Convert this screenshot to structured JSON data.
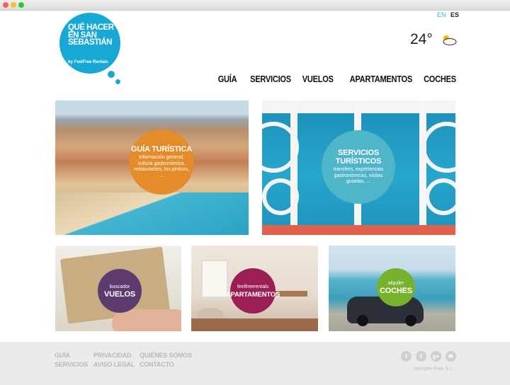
{
  "window": {
    "chrome_buttons": [
      "close",
      "minimize",
      "maximize"
    ]
  },
  "lang": {
    "en": "EN",
    "es": "ES",
    "active": "ES"
  },
  "logo": {
    "title_lines": [
      "QUÉ HACER",
      "EN SAN",
      "SEBASTIÁN"
    ],
    "subtitle": "by FeelFree Rentals",
    "color": "#18a8d5"
  },
  "weather": {
    "temperature": "24°",
    "icon": "partly-cloudy-icon"
  },
  "nav": [
    "GUÍA",
    "SERVICIOS",
    "VUELOS",
    "APARTAMENTOS",
    "COCHES"
  ],
  "tiles": {
    "guia": {
      "title": "GUÍA TURÍSTICA",
      "description": "Información general, cultura gastronómica, restaurantes, los pintxos, ...",
      "color": "#e48b2a"
    },
    "servicios": {
      "title": "SERVICIOS TURÍSTICOS",
      "description": "transfers, experiencias gastronómicas, visitas guiadas, ...",
      "color": "#4fb5c9"
    },
    "vuelos": {
      "pretitle": "buscador",
      "title": "VUELOS",
      "color": "#5d3b6e"
    },
    "apartamentos": {
      "pretitle": "feelfreerentals",
      "title": "APARTAMENTOS",
      "color": "#9c1f54"
    },
    "coches": {
      "pretitle": "alquiler",
      "title": "COCHES",
      "color": "#77b22e"
    }
  },
  "footer": {
    "col1": [
      "GUÍA",
      "SERVICIOS"
    ],
    "col2": [
      "PRIVACIDAD",
      "AVISO LEGAL"
    ],
    "col3": [
      "QUIÉNES SOMOS",
      "CONTACTO"
    ],
    "socials": [
      "twitter-icon",
      "facebook-icon",
      "google-plus-icon",
      "email-icon"
    ],
    "company": "Siempre Free S.L."
  }
}
